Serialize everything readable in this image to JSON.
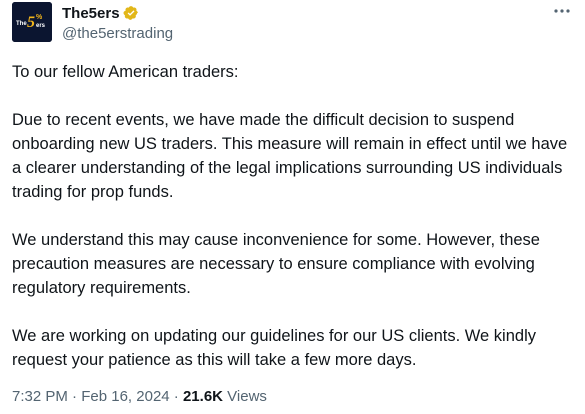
{
  "author": {
    "display_name": "The5ers",
    "handle": "@the5erstrading",
    "avatar_text": "The5%ers",
    "verified_badge_color": "#e2b719"
  },
  "menu": {
    "icon": "more-horizontal-icon"
  },
  "post": {
    "paragraphs": [
      "To our fellow American traders:",
      "Due to recent events, we have made the difficult decision to suspend onboarding new US traders. This measure will remain in effect until we have a clearer understanding of the legal implications surrounding US individuals trading for prop funds.",
      "We understand this may cause inconvenience for some. However, these precaution measures are necessary to ensure compliance with evolving regulatory requirements.",
      "We are working on updating our guidelines for our US clients. We kindly request your patience as this will take a few more days."
    ]
  },
  "meta": {
    "time": "7:32 PM",
    "separator": "·",
    "date": "Feb 16, 2024",
    "views_count": "21.6K",
    "views_label": "Views"
  },
  "colors": {
    "text": "#0f1419",
    "secondary": "#536471",
    "avatar_bg": "#0b1530",
    "avatar_accent": "#f2b51c"
  }
}
